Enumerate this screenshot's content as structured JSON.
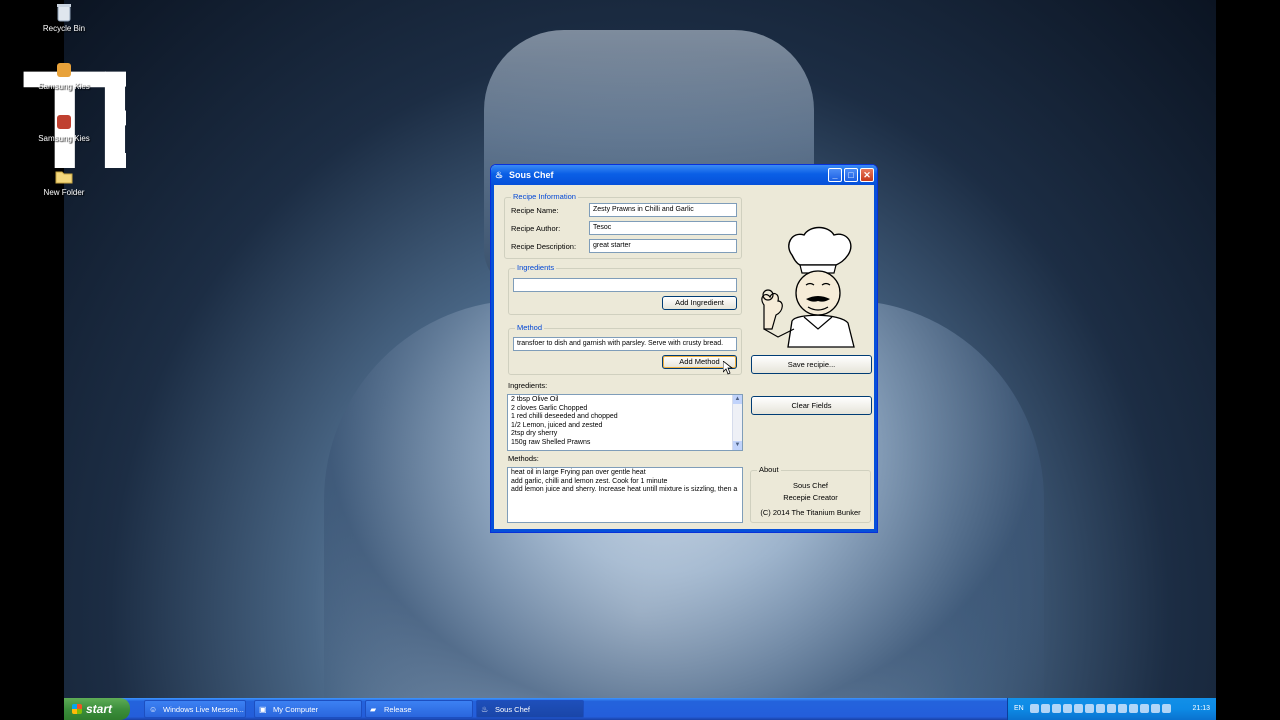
{
  "desktop": {
    "logo_text": "TB",
    "icons": [
      {
        "label": "Recycle Bin"
      },
      {
        "label": "Samsung Kies"
      },
      {
        "label": "Samsung Kies"
      },
      {
        "label": "New Folder"
      }
    ]
  },
  "window": {
    "title": "Sous Chef",
    "recipe_info": {
      "legend": "Recipe Information",
      "name_label": "Recipe Name:",
      "name_value": "Zesty Prawns in Chilli and Garlic",
      "author_label": "Recipe Author:",
      "author_value": "Tesoc",
      "description_label": "Recipe Description:",
      "description_value": "great starter"
    },
    "ingredients_group": {
      "legend": "Ingredients",
      "input_value": "",
      "add_button": "Add Ingredient"
    },
    "method_group": {
      "legend": "Method",
      "input_value": "transfoer to dish and garnish with parsley. Serve with crusty bread.",
      "add_button": "Add Method"
    },
    "ingredients_list": {
      "label": "Ingredients:",
      "items": [
        "2 tbsp Olive Oil",
        "2 cloves Garlic Chopped",
        "1 red chilli deseeded and chopped",
        "1/2 Lemon, juiced and zested",
        "2tsp dry sherry",
        "150g raw Shelled Prawns"
      ]
    },
    "methods_list": {
      "label": "Methods:",
      "items": [
        "heat oil in large Frying pan over gentle heat",
        "add garlic, chilli and lemon zest. Cook for 1 minute",
        "add lemon juice and sherry. Increase heat untill mixture is sizzling, then a"
      ]
    },
    "save_button": "Save recipie...",
    "clear_button": "Clear Fields",
    "about": {
      "legend": "About",
      "line1": "Sous Chef",
      "line2": "Recepie Creator",
      "line3": "(C) 2014 The Titanium Bunker"
    }
  },
  "taskbar": {
    "start_label": "start",
    "tasks": [
      {
        "label": "Windows Live Messen..."
      },
      {
        "label": "My Computer"
      },
      {
        "label": "Release"
      },
      {
        "label": "Sous Chef"
      }
    ],
    "tray": {
      "language": "EN",
      "clock": "21:13"
    }
  }
}
